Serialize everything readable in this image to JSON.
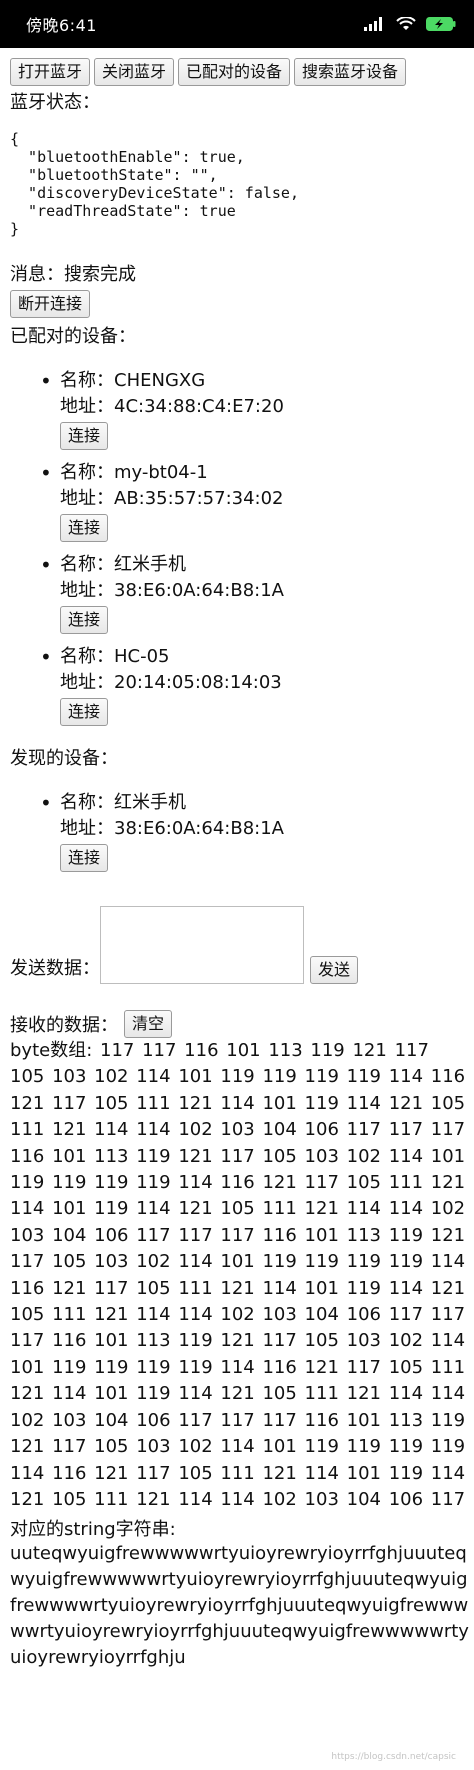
{
  "status_bar": {
    "time": "傍晚6:41",
    "battery_color": "#4cd964"
  },
  "toolbar": {
    "open_bt": "打开蓝牙",
    "close_bt": "关闭蓝牙",
    "paired": "已配对的设备",
    "search": "搜索蓝牙设备"
  },
  "bluetooth": {
    "state_label": "蓝牙状态：",
    "state_json": "{\n  \"bluetoothEnable\": true,\n  \"bluetoothState\": \"\",\n  \"discoveryDeviceState\": false,\n  \"readThreadState\": true\n}"
  },
  "message": {
    "label": "消息：",
    "value": "搜索完成"
  },
  "disconnect_label": "断开连接",
  "paired": {
    "title": "已配对的设备：",
    "devices": [
      {
        "name": "名称：CHENGXG",
        "address": "地址：4C:34:88:C4:E7:20",
        "connect": "连接"
      },
      {
        "name": "名称：my-bt04-1",
        "address": "地址：AB:35:57:57:34:02",
        "connect": "连接"
      },
      {
        "name": "名称：红米手机",
        "address": "地址：38:E6:0A:64:B8:1A",
        "connect": "连接"
      },
      {
        "name": "名称：HC-05",
        "address": "地址：20:14:05:08:14:03",
        "connect": "连接"
      }
    ]
  },
  "discovered": {
    "title": "发现的设备：",
    "devices": [
      {
        "name": "名称：红米手机",
        "address": "地址：38:E6:0A:64:B8:1A",
        "connect": "连接"
      }
    ]
  },
  "send": {
    "label": "发送数据：",
    "value": "",
    "button": "发送"
  },
  "receive": {
    "label": "接收的数据：",
    "clear": "清空",
    "bytes_label": "byte数组:",
    "bytes": "117 117 116 101 113 119 121 117 105 103 102 114 101 119 119 119 119 114 116 121 117 105 111 121 114 101 119 114 121 105 111 121 114 114 102 103 104 106 117 117 117 116 101 113 119 121 117 105 103 102 114 101 119 119 119 119 114 116 121 117 105 111 121 114 101 119 114 121 105 111 121 114 114 102 103 104 106 117 117 117 116 101 113 119 121 117 105 103 102 114 101 119 119 119 119 114 116 121 117 105 111 121 114 101 119 114 121 105 111 121 114 114 102 103 104 106 117 117 117 116 101 113 119 121 117 105 103 102 114 101 119 119 119 119 114 116 121 117 105 111 121 114 101 119 114 121 105 111 121 114 114 102 103 104 106 117 117 117 116 101 113 119 121 117 105 103 102 114 101 119 119 119 119 114 116 121 117 105 111 121 114 101 119 114 121 105 111 121 114 114 102 103 104 106 117",
    "string_label": "对应的string字符串:",
    "string": "uuteqwyuigfrewwwwwrtyuioyrewryioyrrfghjuuuteqwyuigfrewwwwwrtyuioyrewryioyrrfghjuuuteqwyuigfrewwwwrtyuioyrewryioyrrfghjuuuteqwyuigfrewwwwwrtyuioyrewryioyrrfghjuuuteqwyuigfrewwwwwrtyuioyrewryioyrrfghju"
  },
  "watermark": "https://blog.csdn.net/capsic"
}
